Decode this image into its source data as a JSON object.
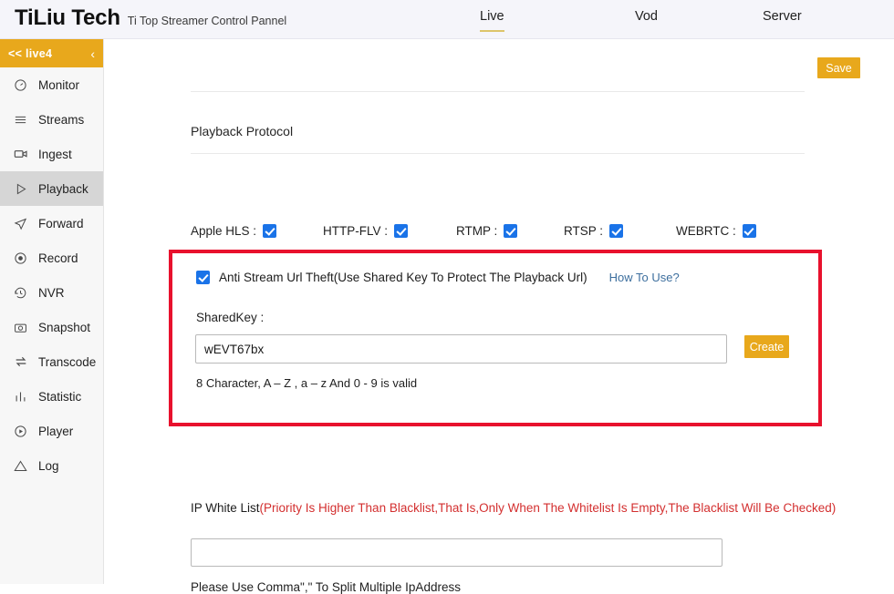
{
  "header": {
    "brand_name": "TiLiu Tech",
    "brand_subtitle": "Ti Top Streamer Control Pannel",
    "tabs": [
      {
        "label": "Live",
        "active": true
      },
      {
        "label": "Vod",
        "active": false
      },
      {
        "label": "Server",
        "active": false
      }
    ]
  },
  "sidebar": {
    "group_header": "<<  live4",
    "collapse_chevron": "‹",
    "items": [
      {
        "label": "Monitor",
        "icon": "gauge-icon",
        "active": false
      },
      {
        "label": "Streams",
        "icon": "list-icon",
        "active": false
      },
      {
        "label": "Ingest",
        "icon": "video-camera-icon",
        "active": false
      },
      {
        "label": "Playback",
        "icon": "play-icon",
        "active": true
      },
      {
        "label": "Forward",
        "icon": "send-icon",
        "active": false
      },
      {
        "label": "Record",
        "icon": "record-dot-icon",
        "active": false
      },
      {
        "label": "NVR",
        "icon": "history-clock-icon",
        "active": false
      },
      {
        "label": "Snapshot",
        "icon": "camera-icon",
        "active": false
      },
      {
        "label": "Transcode",
        "icon": "swap-arrows-icon",
        "active": false
      },
      {
        "label": "Statistic",
        "icon": "bar-chart-icon",
        "active": false
      },
      {
        "label": "Player",
        "icon": "play-circle-icon",
        "active": false
      },
      {
        "label": "Log",
        "icon": "warning-triangle-icon",
        "active": false
      }
    ]
  },
  "main": {
    "save_label": "Save",
    "section_title": "Playback Protocol",
    "protocols": [
      {
        "label": "Apple HLS :",
        "checked": true
      },
      {
        "label": "HTTP-FLV :",
        "checked": true
      },
      {
        "label": "RTMP :",
        "checked": true
      },
      {
        "label": "RTSP :",
        "checked": true
      },
      {
        "label": "WEBRTC :",
        "checked": true
      }
    ],
    "anti_theft": {
      "checked": true,
      "label": "Anti Stream Url Theft(Use Shared Key To Protect The Playback Url)",
      "help_link": "How To Use?",
      "sharedkey_label": "SharedKey :",
      "sharedkey_value": "wEVT67bx",
      "sharedkey_placeholder": "",
      "create_label": "Create",
      "hint": "8 Character, A – Z , a – z And 0 - 9 is valid"
    },
    "ip_white_list": {
      "label": "IP White List",
      "warning": "(Priority Is Higher Than Blacklist,That Is,Only When The Whitelist Is Empty,The Blacklist Will Be Checked)",
      "value": "",
      "placeholder": "",
      "hint": "Please Use Comma\",\" To Split Multiple IpAddress"
    }
  },
  "colors": {
    "accent_amber": "#e8a81c",
    "checkbox_blue": "#1a73e8",
    "highlight_red": "#e8112d",
    "warning_red": "#d32f2f",
    "link_blue": "#3d6f9e",
    "tab_underline": "#ddc56a"
  }
}
